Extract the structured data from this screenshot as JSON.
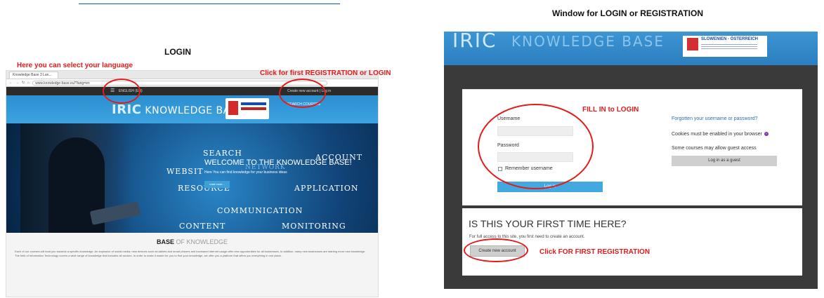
{
  "captions": {
    "left": "LOGIN",
    "right": "Window for LOGIN or REGISTRATION"
  },
  "annotations": {
    "language": "Here you can select your language",
    "first_registration": "Click for first REGISTRATION or LOGIN",
    "fill_in": "FILL IN to LOGIN",
    "click_first": "Click FOR FIRST REGISTRATION"
  },
  "colors": {
    "annotation": "#e31b1b",
    "brand_blue": "#3c9ad8",
    "dark_panel": "#3a3a3a"
  },
  "left_screenshot": {
    "tab_title": "Knowledge Base 3 Lan...",
    "url": "www.knowledge-base.eu/?lang=en",
    "language_menu": "ENGLISH (EN)",
    "account_links": "Create new account | Log in",
    "logo_text": "KNOWLEDGE BASE",
    "logo_prefix": "IRIC",
    "nav_items": "SEARCH   COURSES",
    "hero_words": {
      "search": "SEARCH",
      "account": "ACCOUNT",
      "website": "WEBSIT",
      "network": "NETWORK",
      "resource": "RESOURCE",
      "application": "APPLICATION",
      "communication": "COMMUNICATION",
      "content": "CONTENT",
      "monitoring": "MONITORING"
    },
    "welcome": "WELCOME TO THE KNOWLEDGE BASE!",
    "welcome_sub": "Here You can find knowledge for your business ideas",
    "read_more": "read more...",
    "base_title": "BASE",
    "base_title_suffix": "OF KNOWLEDGE",
    "base_text": "Each of our courses will lead you towards a specific knowledge. An explosion of social media, new devices such as tablets and smart phones and increased internet usage offer new opportunities for all businesses. In addition, many new businesses are starting more new knowledge. The field of Information Technology covers a wide range of knowledge that includes all sectors. In order to make it easier for you to find your knowledge, we offer you a platform that offers you everything in one place."
  },
  "right_screenshot": {
    "logo_prefix": "IRIC",
    "logo_text": "KNOWLEDGE BASE",
    "program_name": "SLOWENIEN - ÖSTERREICH",
    "login": {
      "username_label": "Username",
      "password_label": "Password",
      "remember_label": "Remember username",
      "login_button": "Log in",
      "forgot_link": "Forgotten your username or password?",
      "cookies_note": "Cookies must be enabled in your browser",
      "guest_note": "Some courses may allow guest access",
      "guest_button": "Log in as a guest"
    },
    "first_time": {
      "title": "IS THIS YOUR FIRST TIME HERE?",
      "text": "For full access to this site, you first need to create an account.",
      "create_button": "Create new account"
    }
  }
}
